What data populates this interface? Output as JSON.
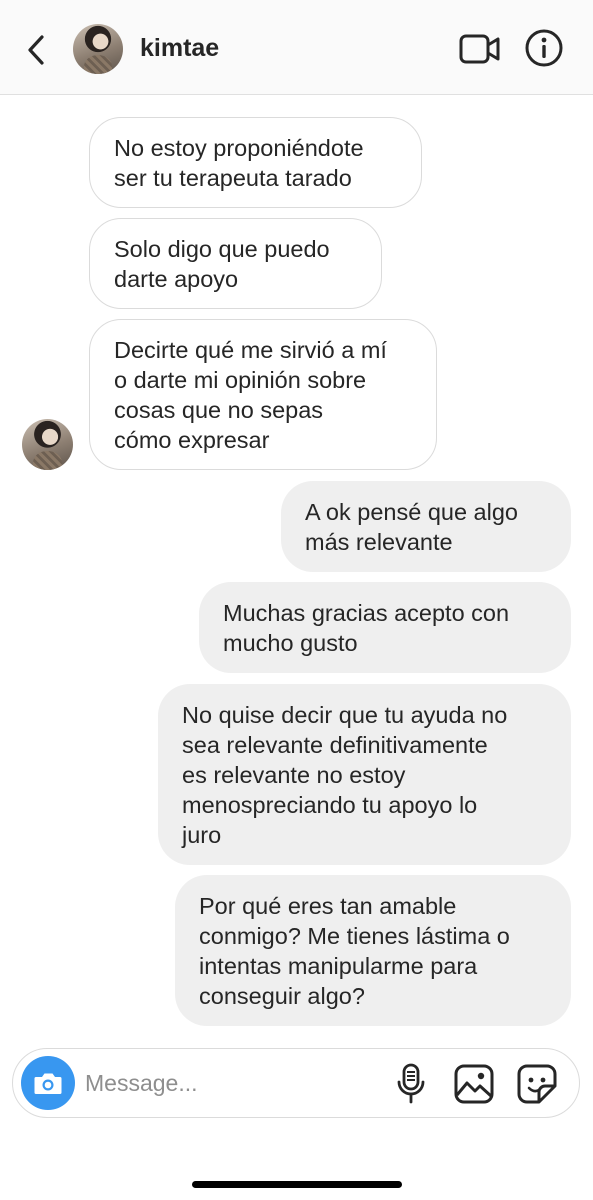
{
  "header": {
    "username": "kimtae",
    "back_icon": "chevron-left-icon",
    "video_icon": "video-camera-icon",
    "info_icon": "info-icon"
  },
  "messages": [
    {
      "from": "them",
      "text": "No estoy proponiéndote\nser tu terapeuta tarado"
    },
    {
      "from": "them",
      "text": "Solo digo que puedo\ndarte apoyo"
    },
    {
      "from": "them",
      "text": "Decirte qué me sirvió a mí\no darte mi opinión sobre\ncosas que no sepas\ncómo expresar"
    },
    {
      "from": "me",
      "text": "A ok pensé que algo\nmás relevante"
    },
    {
      "from": "me",
      "text": "Muchas gracias acepto con\nmucho gusto"
    },
    {
      "from": "me",
      "text": "No quise decir que tu ayuda no\nsea relevante definitivamente\nes relevante no estoy\nmenospreciando tu apoyo lo\njuro"
    },
    {
      "from": "me",
      "text": "Por qué eres tan amable\nconmigo? Me tienes lástima o\nintentas manipularme para\nconseguir algo?"
    }
  ],
  "composer": {
    "placeholder": "Message...",
    "value": "",
    "camera_icon": "camera-icon",
    "mic_icon": "microphone-icon",
    "gallery_icon": "gallery-icon",
    "sticker_icon": "sticker-icon"
  },
  "colors": {
    "accent": "#3897f0",
    "incoming_bubble_border": "#dbdbdb",
    "outgoing_bubble_bg": "#efefef",
    "text": "#262626"
  }
}
